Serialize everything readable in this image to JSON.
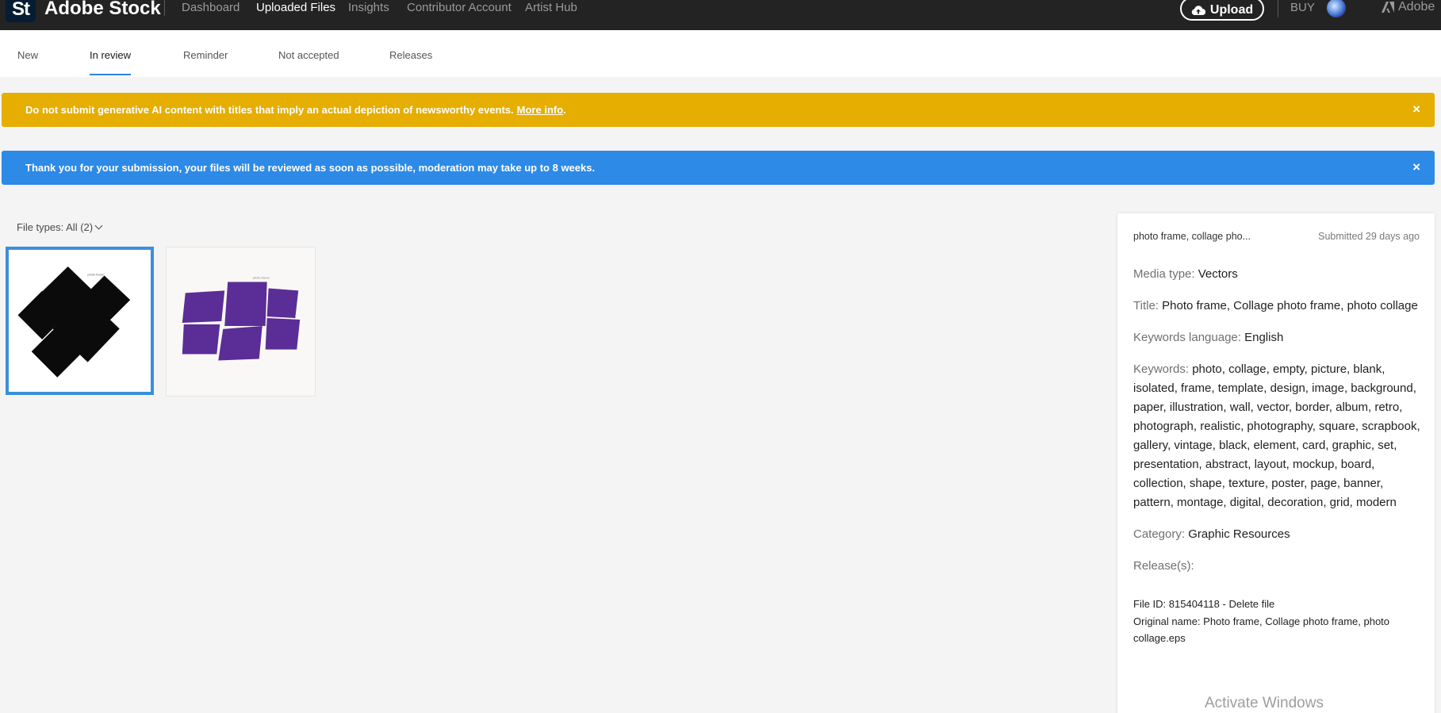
{
  "topbar": {
    "logo": "St",
    "brand": "Adobe Stock",
    "nav": [
      "Dashboard",
      "Uploaded Files",
      "Insights",
      "Contributor Account",
      "Artist Hub"
    ],
    "active_nav": "Uploaded Files",
    "upload_label": "Upload",
    "buy_label": "BUY",
    "adobe_label": "Adobe"
  },
  "tabs": [
    "New",
    "In review",
    "Reminder",
    "Not accepted",
    "Releases"
  ],
  "active_tab": "In review",
  "banners": {
    "warning": {
      "text": "Do not submit generative AI content with titles that imply an actual depiction of newsworthy events.",
      "link": "More info",
      "end": ".",
      "close": "×"
    },
    "info": {
      "text": "Thank you for your submission, your files will be reviewed as soon as possible, moderation may take up to 8 weeks.",
      "close": "×"
    }
  },
  "filter": {
    "label": "File types: All (2)"
  },
  "thumbnails": [
    {
      "name": "black-collage-frame",
      "color": "#0b0b0b",
      "selected": true
    },
    {
      "name": "purple-collage-frame",
      "color": "#5b2d96",
      "selected": false
    }
  ],
  "details": {
    "title_short": "photo frame, collage pho...",
    "submitted": "Submitted 29 days ago",
    "media_type_label": "Media type:",
    "media_type": "Vectors",
    "title_label": "Title:",
    "title": "Photo frame, Collage photo frame, photo collage",
    "keywords_language_label": "Keywords language:",
    "keywords_language": "English",
    "keywords_label": "Keywords:",
    "keywords": "photo, collage, empty, picture, blank, isolated, frame, template, design, image, background, paper, illustration, wall, vector, border, album, retro, photograph, realistic, photography, square, scrapbook, gallery, vintage, black, element, card, graphic, set, presentation, abstract, layout, mockup, board, collection, shape, texture, poster, page, banner, pattern, montage, digital, decoration, grid, modern",
    "category_label": "Category:",
    "category": "Graphic Resources",
    "releases_label": "Release(s):",
    "file_id": "File ID: 815404118 - ",
    "delete_file": "Delete file",
    "original_name": "Original name: Photo frame, Collage photo frame, photo collage.eps"
  },
  "watermark": "Activate Windows"
}
